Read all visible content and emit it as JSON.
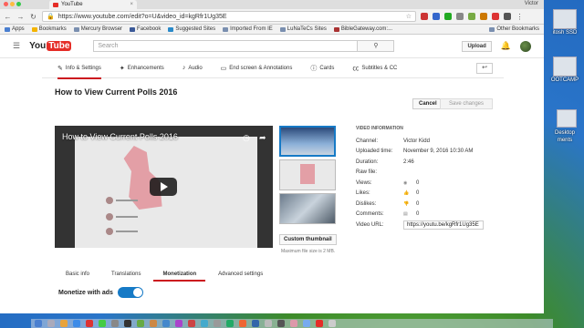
{
  "browser": {
    "tab_title": "YouTube",
    "url": "https://www.youtube.com/edit?o=U&video_id=kgRfr1Ug35E",
    "bookmarks": [
      "Apps",
      "Bookmarks",
      "Mercury Browser",
      "Facebook",
      "Suggested Sites",
      "Imported From IE",
      "LuNaTeCs Sites",
      "BibleGateway.com:..."
    ],
    "other_bookmarks": "Other Bookmarks",
    "user": "Victor"
  },
  "header": {
    "logo_you": "You",
    "logo_tube": "Tube",
    "search_placeholder": "Search",
    "upload_label": "Upload"
  },
  "editor": {
    "tabs": [
      {
        "label": "Info & Settings",
        "icon": "pencil-icon"
      },
      {
        "label": "Enhancements",
        "icon": "wand-icon"
      },
      {
        "label": "Audio",
        "icon": "music-note-icon"
      },
      {
        "label": "End screen & Annotations",
        "icon": "end-screen-icon"
      },
      {
        "label": "Cards",
        "icon": "info-icon"
      },
      {
        "label": "Subtitles & CC",
        "icon": "cc-icon"
      }
    ],
    "undo_label": "↩",
    "title": "How to View Current Polls 2016",
    "cancel_label": "Cancel",
    "save_label": "Save changes"
  },
  "player": {
    "title": "How to View Current Polls 2016"
  },
  "thumbnails": {
    "custom_label": "Custom thumbnail",
    "max_size": "Maximum file size is 2 MB."
  },
  "video_info": {
    "heading": "VIDEO INFORMATION",
    "channel_label": "Channel:",
    "channel": "Victor Kidd",
    "uploaded_label": "Uploaded time:",
    "uploaded": "November 9, 2016 10:30 AM",
    "duration_label": "Duration:",
    "duration": "2:46",
    "raw_label": "Raw file:",
    "views_label": "Views:",
    "views": "0",
    "likes_label": "Likes:",
    "likes": "0",
    "dislikes_label": "Dislikes:",
    "dislikes": "0",
    "comments_label": "Comments:",
    "comments": "0",
    "url_label": "Video URL:",
    "video_url": "https://youtu.be/kgRfr1Ug35E"
  },
  "subtabs": [
    "Basic info",
    "Translations",
    "Monetization",
    "Advanced settings"
  ],
  "monetize_label": "Monetize with ads",
  "desktop": {
    "labels": [
      "itosh SSD",
      "OOTCAMP",
      "Desktop",
      "ments"
    ]
  },
  "colors": {
    "accent_red": "#cc181e",
    "link_blue": "#167ac6"
  }
}
